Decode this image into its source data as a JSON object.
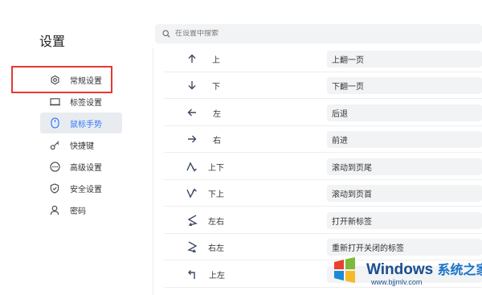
{
  "sidebar": {
    "title": "设置",
    "items": [
      {
        "label": "常规设置",
        "icon": "gear-icon"
      },
      {
        "label": "标签设置",
        "icon": "tab-icon"
      },
      {
        "label": "鼠标手势",
        "icon": "mouse-icon"
      },
      {
        "label": "快捷键",
        "icon": "key-icon"
      },
      {
        "label": "高级设置",
        "icon": "more-icon"
      },
      {
        "label": "安全设置",
        "icon": "shield-icon"
      },
      {
        "label": "密码",
        "icon": "user-icon"
      }
    ],
    "active_item": "鼠标手势"
  },
  "search": {
    "placeholder": "在设置中搜索"
  },
  "gestures": [
    {
      "gesture": "上",
      "action": "上翻一页",
      "icon": "arrow-up-icon"
    },
    {
      "gesture": "下",
      "action": "下翻一页",
      "icon": "arrow-down-icon"
    },
    {
      "gesture": "左",
      "action": "后退",
      "icon": "arrow-left-icon"
    },
    {
      "gesture": "右",
      "action": "前进",
      "icon": "arrow-right-icon"
    },
    {
      "gesture": "上下",
      "action": "滚动到页尾",
      "icon": "gesture-up-down-icon"
    },
    {
      "gesture": "下上",
      "action": "滚动到页首",
      "icon": "gesture-down-up-icon"
    },
    {
      "gesture": "左右",
      "action": "打开新标签",
      "icon": "gesture-left-right-icon"
    },
    {
      "gesture": "右左",
      "action": "重新打开关闭的标签",
      "icon": "gesture-right-left-icon"
    },
    {
      "gesture": "上左",
      "action": "",
      "icon": "gesture-up-left-icon"
    }
  ],
  "watermark": {
    "brand": "Windows",
    "brand_suffix": "系统之家",
    "url": "www.bjjmlv.com"
  },
  "colors": {
    "accent": "#3478f6",
    "highlight": "#e53935",
    "active_bg": "#e8ecf1",
    "field_bg": "#f1f3f5"
  }
}
